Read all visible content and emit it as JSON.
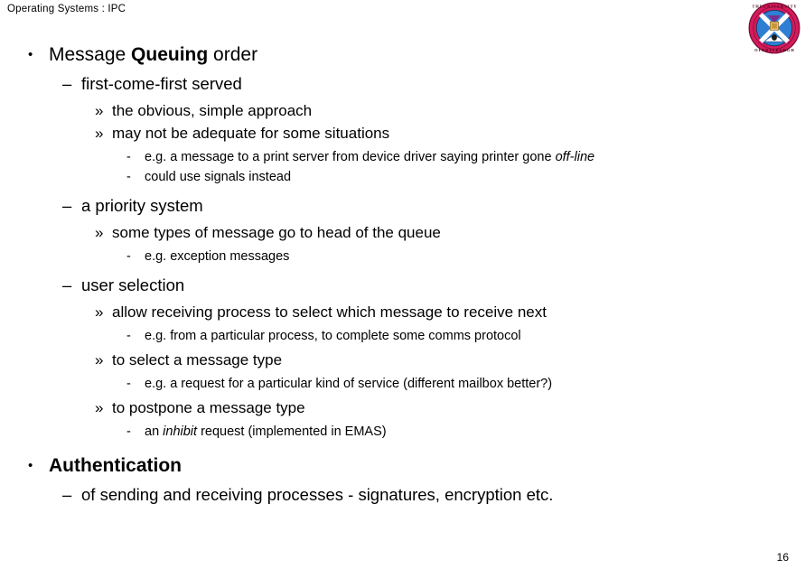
{
  "header": {
    "title": "Operating Systems : IPC"
  },
  "crest": {
    "name": "university-of-edinburgh-crest",
    "ring_text_top": "THE UNIVERSITY",
    "ring_text_bottom": "OF EDINBURGH",
    "colors": {
      "ring": "#D61A5C",
      "ring_outline": "#7A0F35",
      "shield_blue": "#2E7FD4",
      "shield_white": "#FFFFFF",
      "accent_purple": "#7B2D8E",
      "gold": "#E8C56A"
    }
  },
  "slide": {
    "bullets": [
      {
        "level": 1,
        "marker": "•",
        "spacing": "none",
        "runs": [
          {
            "text": "Message ",
            "style": "normal"
          },
          {
            "text": "Queuing",
            "style": "bold"
          },
          {
            "text": " order",
            "style": "normal"
          }
        ]
      },
      {
        "level": 2,
        "marker": "–",
        "spacing": "gap-sm",
        "runs": [
          {
            "text": "first-come-first served",
            "style": "normal"
          }
        ]
      },
      {
        "level": 3,
        "marker": "»",
        "spacing": "gap-sm",
        "runs": [
          {
            "text": "the obvious, simple approach",
            "style": "normal"
          }
        ]
      },
      {
        "level": 3,
        "marker": "»",
        "spacing": "none",
        "runs": [
          {
            "text": "may not be adequate for some situations",
            "style": "normal"
          }
        ]
      },
      {
        "level": 4,
        "marker": "-",
        "spacing": "gap-sm",
        "runs": [
          {
            "text": "e.g. a message to a print server from device driver saying printer gone ",
            "style": "normal"
          },
          {
            "text": "off-line",
            "style": "italic"
          }
        ]
      },
      {
        "level": 4,
        "marker": "-",
        "spacing": "none",
        "runs": [
          {
            "text": "could use signals instead",
            "style": "normal"
          }
        ]
      },
      {
        "level": 2,
        "marker": "–",
        "spacing": "gap-md",
        "runs": [
          {
            "text": "a priority system",
            "style": "normal"
          }
        ]
      },
      {
        "level": 3,
        "marker": "»",
        "spacing": "gap-sm",
        "runs": [
          {
            "text": "some types of message go to head of the queue",
            "style": "normal"
          }
        ]
      },
      {
        "level": 4,
        "marker": "-",
        "spacing": "gap-sm",
        "runs": [
          {
            "text": "e.g. exception messages",
            "style": "normal"
          }
        ]
      },
      {
        "level": 2,
        "marker": "–",
        "spacing": "gap-md",
        "runs": [
          {
            "text": "user selection",
            "style": "normal"
          }
        ]
      },
      {
        "level": 3,
        "marker": "»",
        "spacing": "gap-sm",
        "runs": [
          {
            "text": "allow receiving process to select which message to receive next",
            "style": "normal"
          }
        ]
      },
      {
        "level": 4,
        "marker": "-",
        "spacing": "gap-sm",
        "runs": [
          {
            "text": "e.g. from a particular process, to complete some comms protocol",
            "style": "normal"
          }
        ]
      },
      {
        "level": 3,
        "marker": "»",
        "spacing": "gap-sm",
        "runs": [
          {
            "text": "to select a message type",
            "style": "normal"
          }
        ]
      },
      {
        "level": 4,
        "marker": "-",
        "spacing": "gap-sm",
        "runs": [
          {
            "text": "e.g. a request for a particular kind of service (different mailbox better?)",
            "style": "normal"
          }
        ]
      },
      {
        "level": 3,
        "marker": "»",
        "spacing": "gap-sm",
        "runs": [
          {
            "text": "to postpone a message type",
            "style": "normal"
          }
        ]
      },
      {
        "level": 4,
        "marker": "-",
        "spacing": "gap-sm",
        "runs": [
          {
            "text": "an ",
            "style": "normal"
          },
          {
            "text": "inhibit",
            "style": "italic"
          },
          {
            "text": " request (implemented in EMAS)",
            "style": "normal"
          }
        ]
      },
      {
        "level": 1,
        "marker": "•",
        "spacing": "gap-lg",
        "runs": [
          {
            "text": "Authentication",
            "style": "bold"
          }
        ]
      },
      {
        "level": 2,
        "marker": "–",
        "spacing": "gap-sm",
        "runs": [
          {
            "text": "of sending and receiving processes - signatures, encryption etc.",
            "style": "normal"
          }
        ]
      }
    ]
  },
  "footer": {
    "page_number": "16"
  }
}
